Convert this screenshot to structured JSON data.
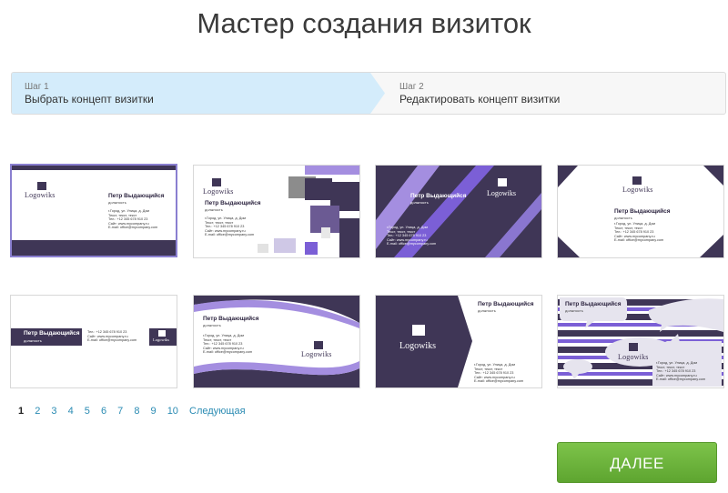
{
  "page": {
    "title": "Мастер создания визиток"
  },
  "steps": [
    {
      "label": "Шаг 1",
      "text": "Выбрать концепт визитки",
      "active": true
    },
    {
      "label": "Шаг 2",
      "text": "Редактировать концепт визитки",
      "active": false
    }
  ],
  "card": {
    "name": "Петр Выдающийся",
    "position": "должность",
    "logo": "Logowiks",
    "address": "г.Город, ул. Улица, д. Дом",
    "text": "Текст, текст, текст",
    "phone": "Тел.: +12 345 678 910 23",
    "site": "Сайт: www.mycompany.ru",
    "email": "E-mail: office@mycompany.com"
  },
  "pagination": {
    "pages": [
      "1",
      "2",
      "3",
      "4",
      "5",
      "6",
      "7",
      "8",
      "9",
      "10"
    ],
    "current": "1",
    "next_label": "Следующая"
  },
  "next_button": {
    "label": "ДАЛЕЕ"
  },
  "colors": {
    "dark": "#3f3656",
    "violet": "#7b5fd6",
    "light_violet": "#a48ee0",
    "green": "#6cb43e",
    "step_active": "#d4ecfb"
  }
}
